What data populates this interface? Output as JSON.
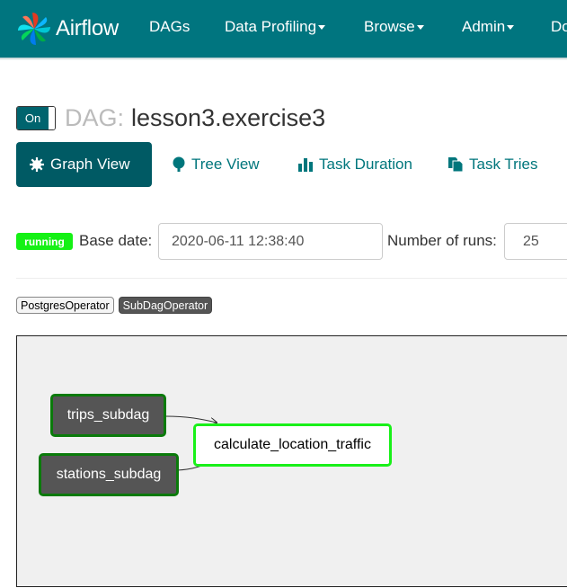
{
  "nav": {
    "brand": "Airflow",
    "items": [
      {
        "label": "DAGs",
        "dropdown": false
      },
      {
        "label": "Data Profiling",
        "dropdown": true
      },
      {
        "label": "Browse",
        "dropdown": true
      },
      {
        "label": "Admin",
        "dropdown": true
      },
      {
        "label": "Do",
        "dropdown": false
      }
    ]
  },
  "dag": {
    "toggle_label": "On",
    "prefix": "DAG:",
    "id": "lesson3.exercise3"
  },
  "tabs": [
    {
      "label": "Graph View",
      "icon": "asterisk-icon",
      "active": true
    },
    {
      "label": "Tree View",
      "icon": "tree-icon",
      "active": false
    },
    {
      "label": "Task Duration",
      "icon": "bar-chart-icon",
      "active": false
    },
    {
      "label": "Task Tries",
      "icon": "duplicate-icon",
      "active": false
    }
  ],
  "controls": {
    "state_badge": "running",
    "base_date_label": "Base date:",
    "base_date_value": "2020-06-11 12:38:40",
    "num_runs_label": "Number of runs:",
    "num_runs_value": "25"
  },
  "operators": [
    "PostgresOperator",
    "SubDagOperator"
  ],
  "graph": {
    "nodes": [
      {
        "id": "trips_subdag",
        "label": "trips_subdag",
        "type": "subdag"
      },
      {
        "id": "stations_subdag",
        "label": "stations_subdag",
        "type": "subdag"
      },
      {
        "id": "calculate_location_traffic",
        "label": "calculate_location_traffic",
        "type": "task"
      }
    ]
  },
  "colors": {
    "navbar": "#00757f",
    "running": "#15f115",
    "success_border": "#19f019",
    "subdag_border": "#0a7a0a"
  }
}
